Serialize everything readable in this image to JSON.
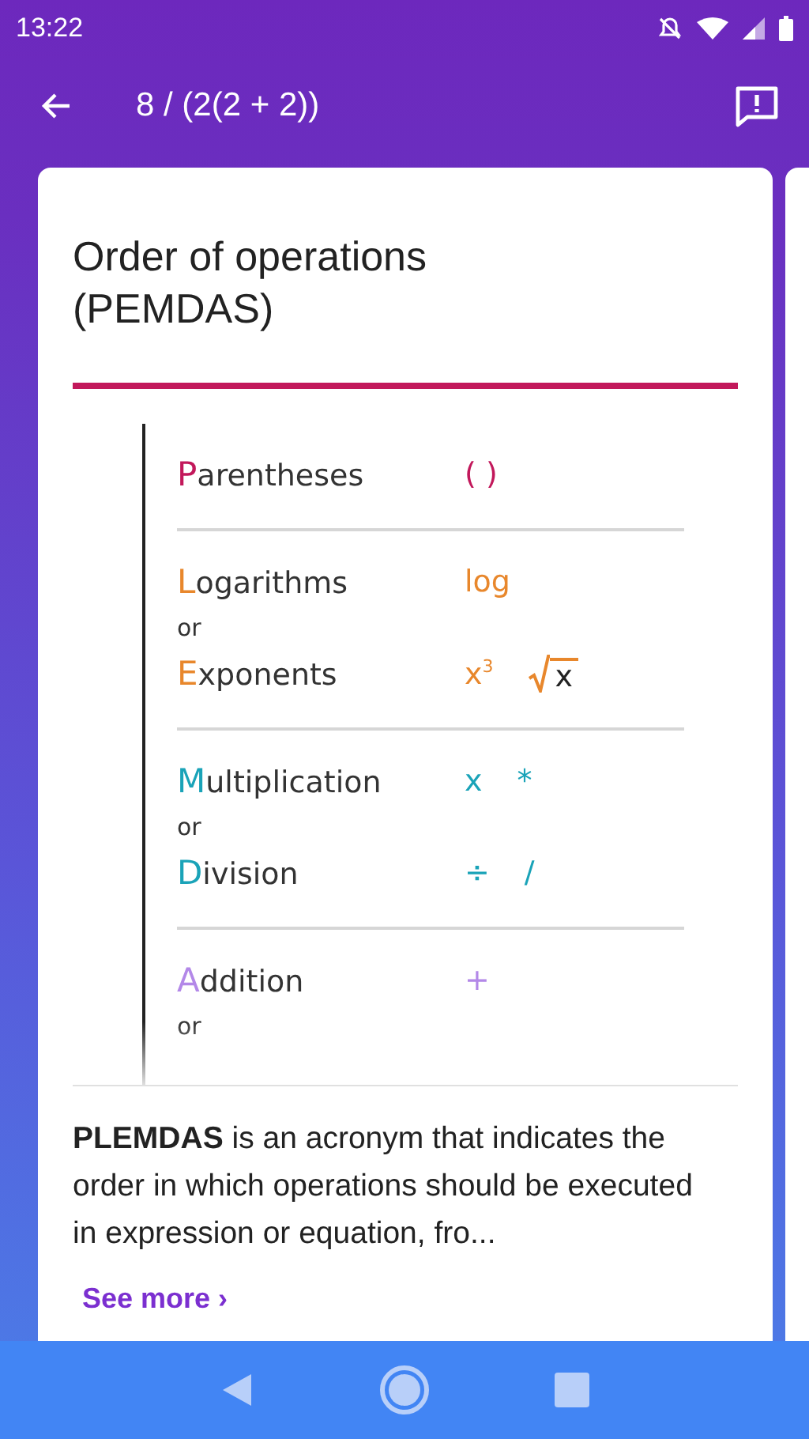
{
  "status_bar": {
    "time": "13:22"
  },
  "app_bar": {
    "title": "8 / (2(2 + 2))"
  },
  "card": {
    "title": "Order of operations (PEMDAS)",
    "sections": [
      {
        "color": "#c2185b",
        "rows": [
          {
            "kind": "term",
            "text": "Parentheses",
            "symbols": [
              {
                "kind": "text",
                "text": "( )"
              }
            ]
          }
        ]
      },
      {
        "color": "#e8872c",
        "rows": [
          {
            "kind": "term",
            "text": "Logarithms",
            "symbols": [
              {
                "kind": "text",
                "text": "log"
              }
            ]
          },
          {
            "kind": "or",
            "text": "or"
          },
          {
            "kind": "term",
            "text": "Exponents",
            "symbols": [
              {
                "kind": "text",
                "text": "x$^{3}$"
              },
              {
                "kind": "root",
                "text": "x"
              }
            ]
          }
        ]
      },
      {
        "color": "#1aa3b8",
        "rows": [
          {
            "kind": "term",
            "text": "Multiplication",
            "symbols": [
              {
                "kind": "text",
                "text": "x"
              },
              {
                "kind": "text",
                "text": "*"
              }
            ]
          },
          {
            "kind": "or",
            "text": "or"
          },
          {
            "kind": "term",
            "text": "Division",
            "symbols": [
              {
                "kind": "text",
                "text": "÷"
              },
              {
                "kind": "text",
                "text": "/"
              }
            ]
          }
        ]
      },
      {
        "color": "#b388e8",
        "rows": [
          {
            "kind": "term",
            "text": "Addition",
            "symbols": [
              {
                "kind": "text",
                "text": "+"
              }
            ]
          },
          {
            "kind": "or",
            "text": "or"
          }
        ]
      }
    ],
    "description": "**PLEMDAS** is an acronym that indicates the order in which operations should be executed in expression or equation, fro...",
    "link": "See more ›"
  }
}
